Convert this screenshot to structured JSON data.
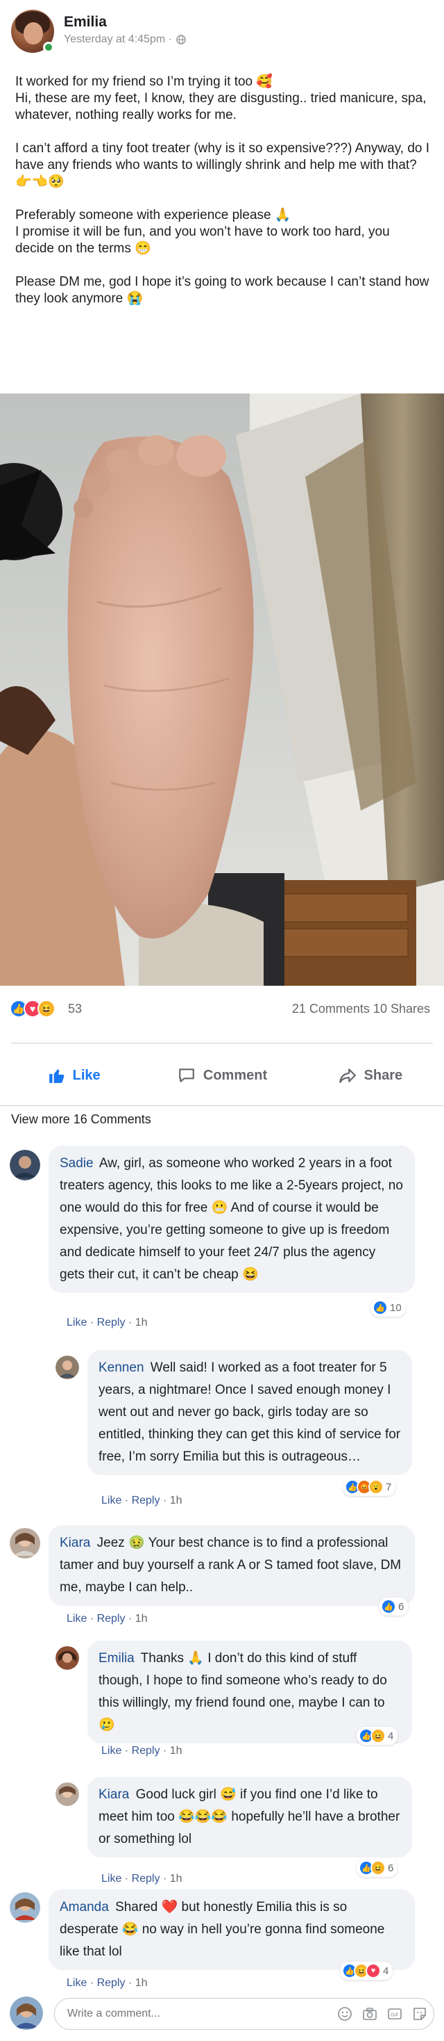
{
  "post": {
    "author": "Emilia",
    "time": "Yesterday at 4:45pm ·",
    "paragraphs": [
      "It worked for my friend so I’m trying it too 🥰\nHi, these are my feet, I know, they are disgusting.. tried manicure, spa, whatever, nothing really works for me.",
      "I can’t afford a tiny foot treater (why is it so expensive???) Anyway, do I have any friends who wants to willingly shrink and help me with that? 👉👈🥺",
      "Preferably someone with experience please 🙏\nI promise it will be fun, and you won’t have to work too hard, you decide on the terms 😁",
      "Please DM me, god I hope it’s going to work because I can’t stand how they look anymore 😭"
    ]
  },
  "reactions": {
    "count": "53",
    "comments_shares": "21 Comments 10 Shares"
  },
  "actions": {
    "like": "Like",
    "comment": "Comment",
    "share": "Share"
  },
  "view_more": "View more 16 Comments",
  "comments": [
    {
      "author": "Sadie",
      "text": "Aw, girl, as someone who worked 2 years in a foot treaters agency, this looks to me like a 2-5years project, no one would do this for free 😬 And of course it would be expensive, you’re getting someone to give up is freedom and dedicate himself to your feet 24/7 plus the agency gets their cut, it can’t be cheap 😆",
      "like": "Like",
      "reply": "Reply",
      "time": "1h",
      "count": "10"
    },
    {
      "author": "Kennen",
      "text": "Well said! I worked as a foot treater for 5 years, a nightmare! Once I saved enough money I went out and never go back, girls today are so entitled, thinking they can get this kind of service for free, I’m sorry Emilia but this is outrageous…",
      "like": "Like",
      "reply": "Reply",
      "time": "1h",
      "count": "7"
    },
    {
      "author": "Kiara",
      "text": "Jeez 🤢 Your best chance is to find a professional tamer and buy yourself a rank A or S tamed foot slave, DM me, maybe I can help..",
      "like": "Like",
      "reply": "Reply",
      "time": "1h",
      "count": "6"
    },
    {
      "author": "Emilia",
      "text": "Thanks 🙏 I don’t do this kind of stuff though, I hope to find someone who’s ready to do this willingly, my friend found one, maybe I can to 🥲",
      "like": "Like",
      "reply": "Reply",
      "time": "1h",
      "count": "4"
    },
    {
      "author": "Kiara",
      "text": "Good luck girl 😅 if you find one I’d like to meet him too 😂😂😂 hopefully he’ll have a brother or something lol",
      "like": "Like",
      "reply": "Reply",
      "time": "1h",
      "count": "6"
    },
    {
      "author": "Amanda",
      "text": "Shared ❤️ but honestly Emilia this is so desperate 😂 no way in hell you’re gonna find someone like that lol",
      "like": "Like",
      "reply": "Reply",
      "time": "1h",
      "count": "4"
    }
  ],
  "composer": {
    "placeholder": "Write a comment..."
  },
  "colors": {
    "brand_blue": "#1877f2",
    "author_blue": "#1a4d8f",
    "bubble": "#f0f2f5",
    "muted": "#65676b"
  }
}
